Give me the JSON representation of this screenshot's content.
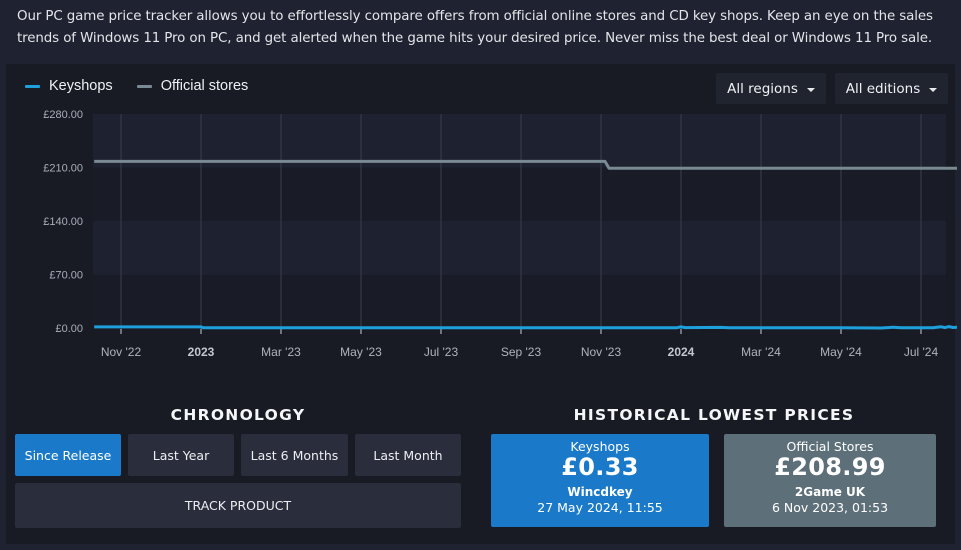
{
  "intro": {
    "text": "Our PC game price tracker allows you to effortlessly compare offers from official online stores and CD key shops. Keep an eye on the sales trends of Windows 11 Pro on PC, and get alerted when the game hits your desired price. Never miss the best deal or Windows 11 Pro sale."
  },
  "legend": {
    "items": [
      {
        "label": "Keyshops",
        "color": "#1ea0dc"
      },
      {
        "label": "Official stores",
        "color": "#7a8a92"
      }
    ]
  },
  "filters": {
    "region": "All regions",
    "edition": "All editions"
  },
  "chart_data": {
    "type": "line",
    "title": "",
    "xlabel": "",
    "ylabel": "",
    "ylim": [
      0,
      280
    ],
    "yticks": [
      "£0.00",
      "£70.00",
      "£140.00",
      "£210.00",
      "£280.00"
    ],
    "ytick_values": [
      0,
      70,
      140,
      210,
      280
    ],
    "xticks": [
      {
        "label": "Nov '22",
        "bold": false,
        "month_index": 1
      },
      {
        "label": "2023",
        "bold": true,
        "month_index": 3
      },
      {
        "label": "Mar '23",
        "bold": false,
        "month_index": 5
      },
      {
        "label": "May '23",
        "bold": false,
        "month_index": 7
      },
      {
        "label": "Jul '23",
        "bold": false,
        "month_index": 9
      },
      {
        "label": "Sep '23",
        "bold": false,
        "month_index": 11
      },
      {
        "label": "Nov '23",
        "bold": false,
        "month_index": 13
      },
      {
        "label": "2024",
        "bold": true,
        "month_index": 15
      },
      {
        "label": "Mar '24",
        "bold": false,
        "month_index": 17
      },
      {
        "label": "May '24",
        "bold": false,
        "month_index": 19
      },
      {
        "label": "Jul '24",
        "bold": false,
        "month_index": 21
      }
    ],
    "x_range_months": [
      0.33,
      21.9
    ],
    "grid": true,
    "legend_position": "top-left",
    "series": [
      {
        "name": "Official stores",
        "color": "#7a8a92",
        "points": [
          [
            0.33,
            218
          ],
          [
            13.1,
            218
          ],
          [
            13.2,
            209
          ],
          [
            21.9,
            209
          ]
        ]
      },
      {
        "name": "Keyshops",
        "color": "#1ea0dc",
        "points": [
          [
            0.33,
            1.5
          ],
          [
            3.0,
            1.5
          ],
          [
            3.05,
            0.4
          ],
          [
            14.9,
            0.4
          ],
          [
            15.0,
            1.6
          ],
          [
            15.1,
            0.5
          ],
          [
            16.0,
            0.8
          ],
          [
            16.2,
            0.2
          ],
          [
            19.0,
            0.2
          ],
          [
            20.0,
            0.0
          ],
          [
            20.3,
            0.9
          ],
          [
            20.5,
            0.2
          ],
          [
            21.3,
            0.3
          ],
          [
            21.5,
            1.6
          ],
          [
            21.6,
            0.5
          ],
          [
            21.7,
            1.8
          ],
          [
            21.8,
            0.6
          ],
          [
            21.9,
            0.9
          ]
        ]
      }
    ]
  },
  "chronology": {
    "title": "CHRONOLOGY",
    "buttons": [
      "Since Release",
      "Last Year",
      "Last 6 Months",
      "Last Month"
    ],
    "active_index": 0,
    "track_label": "TRACK PRODUCT"
  },
  "lowest": {
    "title": "HISTORICAL LOWEST PRICES",
    "cards": [
      {
        "label": "Keyshops",
        "price": "£0.33",
        "shop": "Wincdkey",
        "date": "27 May 2024, 11:55",
        "color": "#1a7ac9"
      },
      {
        "label": "Official Stores",
        "price": "£208.99",
        "shop": "2Game UK",
        "date": "6 Nov 2023, 01:53",
        "color": "#5d6f78"
      }
    ]
  }
}
